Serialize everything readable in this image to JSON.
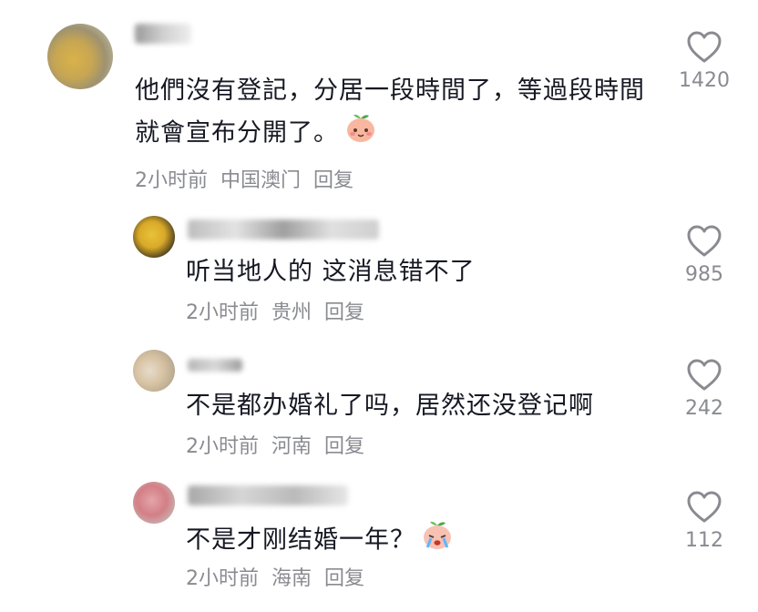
{
  "comments": [
    {
      "text": "他們沒有登記，分居一段時間了，等過段時間就會宣布分開了。",
      "time": "2小时前",
      "location": "中国澳门",
      "reply": "回复",
      "likes": "1420",
      "emoji": "peach-face-emoji"
    },
    {
      "text": "听当地人的 这消息错不了",
      "time": "2小时前",
      "location": "贵州",
      "reply": "回复",
      "likes": "985"
    },
    {
      "text": "不是都办婚礼了吗，居然还没登记啊",
      "time": "2小时前",
      "location": "河南",
      "reply": "回复",
      "likes": "242"
    },
    {
      "text": "不是才刚结婚一年？",
      "time": "2小时前",
      "location": "海南",
      "reply": "回复",
      "likes": "112",
      "emoji": "crying-face-emoji"
    }
  ],
  "colors": {
    "text": "#161823",
    "meta": "#8a8b91",
    "heart": "#8a8b91"
  },
  "icons": {
    "like": "heart-outline-icon"
  }
}
